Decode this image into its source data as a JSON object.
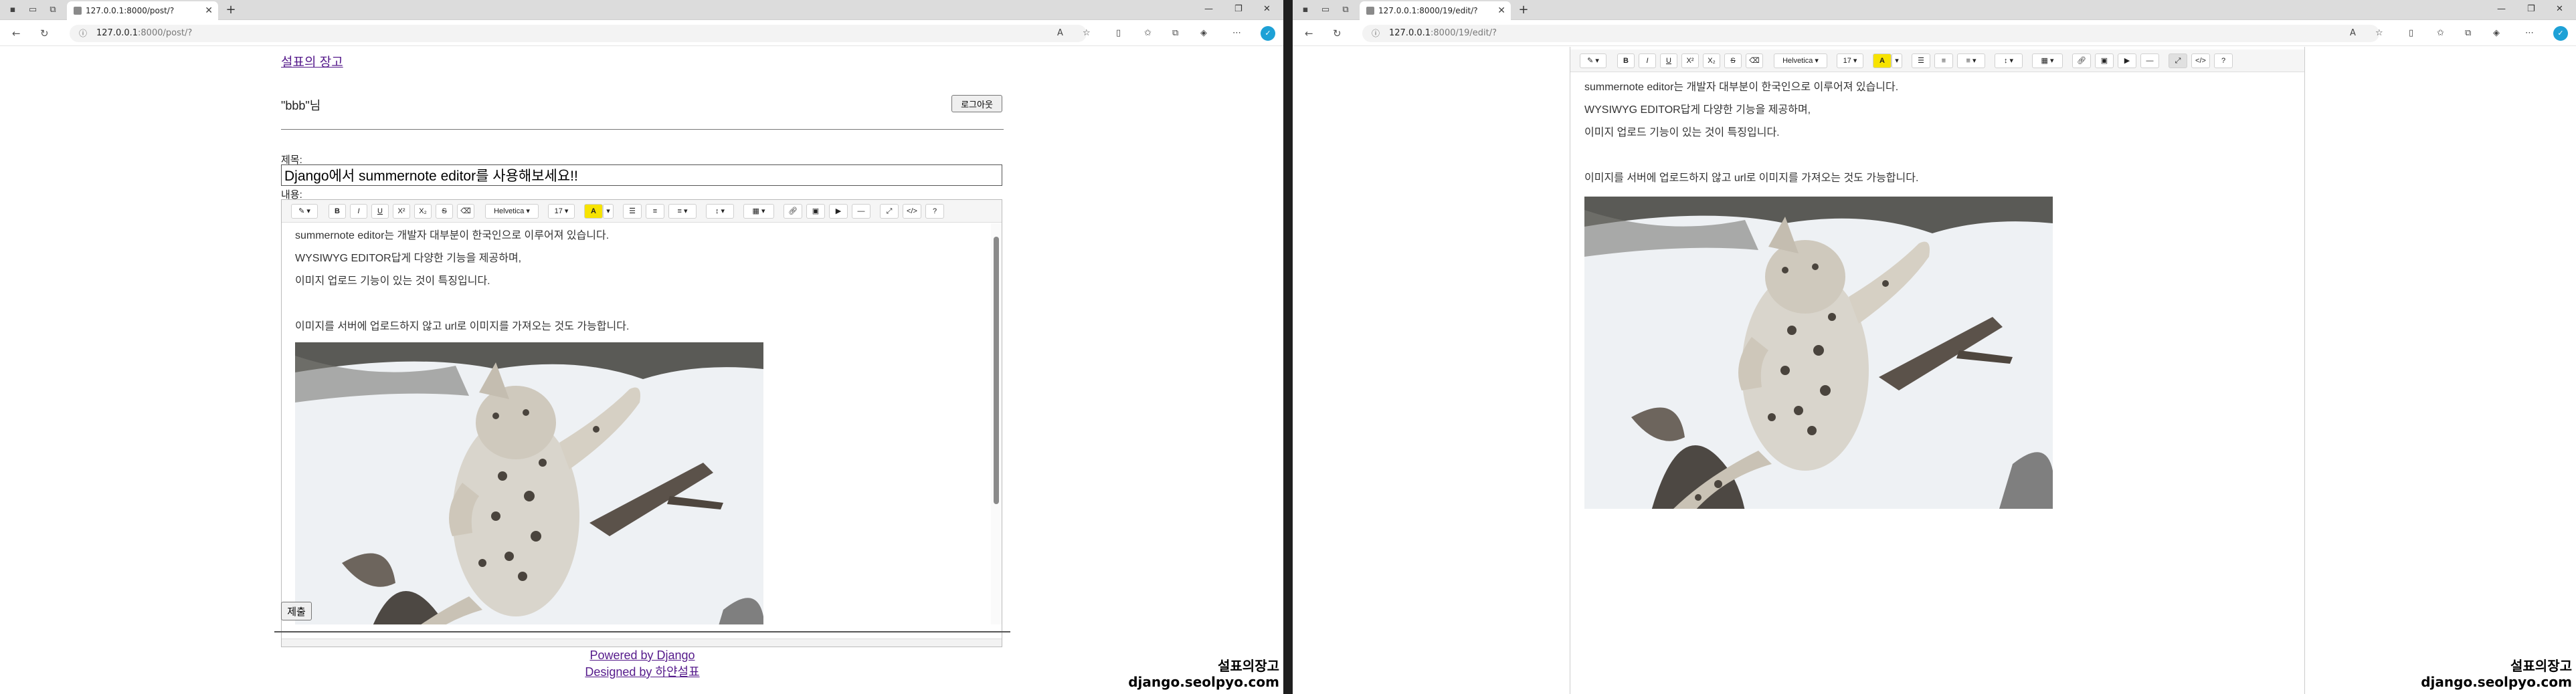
{
  "left": {
    "tab_title": "127.0.0.1:8000/post/?",
    "url_host": "127.0.0.1",
    "url_rest": ":8000/post/?",
    "site_title": "설표의 장고",
    "user_greeting": "\"bbb\"님",
    "logout_label": "로그아웃",
    "title_label": "제목:",
    "title_value": "Django에서 summernote editor를 사용해보세요!!",
    "content_label": "내용:",
    "submit_label": "제출",
    "footer_powered": "Powered by Django",
    "footer_designed": "Designed by 하얀설표"
  },
  "right": {
    "tab_title": "127.0.0.1:8000/19/edit/?",
    "url_host": "127.0.0.1",
    "url_rest": ":8000/19/edit/?"
  },
  "editor": {
    "font_name": "Helvetica",
    "font_size": "17",
    "lines": [
      "summernote editor는 개발자 대부분이 한국인으로 이루어져 있습니다.",
      "WYSIWYG EDITOR답게 다양한 기능을 제공하며,",
      "이미지 업로드 기능이 있는 것이 특징입니다.",
      "",
      "이미지를 서버에 업로드하지 않고 url로 이미지를 가져오는 것도 가능합니다."
    ]
  },
  "watermark": {
    "line1": "설표의장고",
    "line2": "django.seolpyo.com"
  },
  "icons": {
    "back": "back-arrow-icon",
    "refresh": "refresh-icon",
    "info": "site-info-icon",
    "profile": "profile-icon"
  }
}
